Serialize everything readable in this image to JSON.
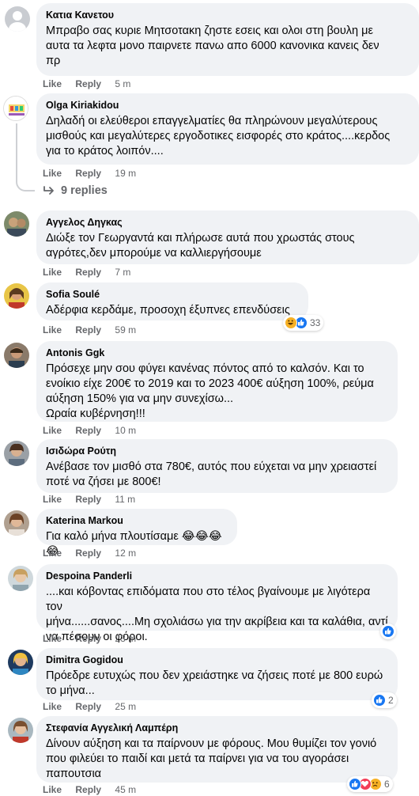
{
  "comments": [
    {
      "name": "Κατια Κανετου",
      "text": "Μπραβο σας κυριε Μητσοτακη ζηστε εσεις και ολοι στη βουλη με\nαυτα τα λεφτα μονο παιρνετε πανω απο 6000 κανονικα κανεις δεν\nπρ",
      "like": "Like",
      "reply": "Reply",
      "time": "5 m"
    },
    {
      "name": "Olga Kiriakidou",
      "text": "Δηλαδή οι ελεύθεροι επαγγελματίες θα πληρώνουν μεγαλύτερους\nμισθούς και μεγαλύτερες εργοδοτικες εισφορές στο κράτος....κερδος\nγια το κράτος λοιπόν....",
      "like": "Like",
      "reply": "Reply",
      "time": "19 m",
      "replies": "9 replies"
    },
    {
      "name": "Αγγελος Δηγκας",
      "text": "Διώξε τον Γεωργαντά και πλήρωσε αυτά που χρωστάς στους\nαγρότες,δεν μπορούμε να καλλιεργήσουμε",
      "like": "Like",
      "reply": "Reply",
      "time": "7 m"
    },
    {
      "name": "Sofia Soulé",
      "text": "Αδέρφια κερδάμε, προσοχη έξυπνες επενδύσεις",
      "like": "Like",
      "reply": "Reply",
      "time": "59 m",
      "reaction_count": "33",
      "reaction_icons": [
        "haha-icon",
        "like-icon"
      ]
    },
    {
      "name": "Antonis Ggk",
      "text": "Πρόσεχε μην σου φύγει κανένας πόντος από το καλσόν. Και το\nενοίκιο είχε 200€ το 2019 και το 2023 400€ αύξηση 100%, ρεύμα\nαύξηση 150% για να μην συνεχίσω...\nΩραία κυβέρνηση!!!",
      "like": "Like",
      "reply": "Reply",
      "time": "10 m"
    },
    {
      "name": "Ισιδώρα Ρούτη",
      "text": "Ανέβασε τον μισθό στα 780€, αυτός που εύχεται να μην χρειαστεί\nποτέ να ζήσει με 800€!",
      "like": "Like",
      "reply": "Reply",
      "time": "11 m"
    },
    {
      "name": "Katerina Markou",
      "text": "Για καλό μήνα πλουτίσαμε 😂😂😂😂",
      "like": "Like",
      "reply": "Reply",
      "time": "12 m"
    },
    {
      "name": "Despoina Panderli",
      "text": "....και κόβοντας επιδόματα που στο τέλος βγαίνουμε με λιγότερα τον\nμήνα......σανος....Μη σχολιάσω για την ακρίβεια και τα καλάθια, αντί\nνα πέσουν οι φόροι.",
      "like": "Like",
      "reply": "Reply",
      "time": "23 m",
      "reaction_count": "",
      "reaction_icons": [
        "like-icon"
      ]
    },
    {
      "name": "Dimitra Gogidou",
      "text": "Πρόεδρε ευτυχώς που δεν χρειάστηκε να ζήσεις ποτέ με 800 ευρώ\nτο μήνα...",
      "like": "Like",
      "reply": "Reply",
      "time": "25 m",
      "reaction_count": "2",
      "reaction_icons": [
        "like-icon"
      ]
    },
    {
      "name": "Στεφανία Αγγελική Λαμπέρη",
      "text": "Δίνουν αύξηση και τα παίρνουν με φόρους. Μου θυμίζει τον γονιό\nπου φιλεύει το παιδί και μετά τα παίρνει για να του αγοράσει\nπαπουτσια",
      "like": "Like",
      "reply": "Reply",
      "time": "45 m",
      "reaction_count": "6",
      "reaction_icons": [
        "like-icon",
        "love-icon",
        "sad-icon"
      ]
    }
  ],
  "colors": {
    "bubble": "#f0f2f5",
    "secondary_text": "#65676b",
    "like_blue": "#1877f2",
    "love_red": "#f33e58",
    "haha_yellow": "#f7b125"
  }
}
